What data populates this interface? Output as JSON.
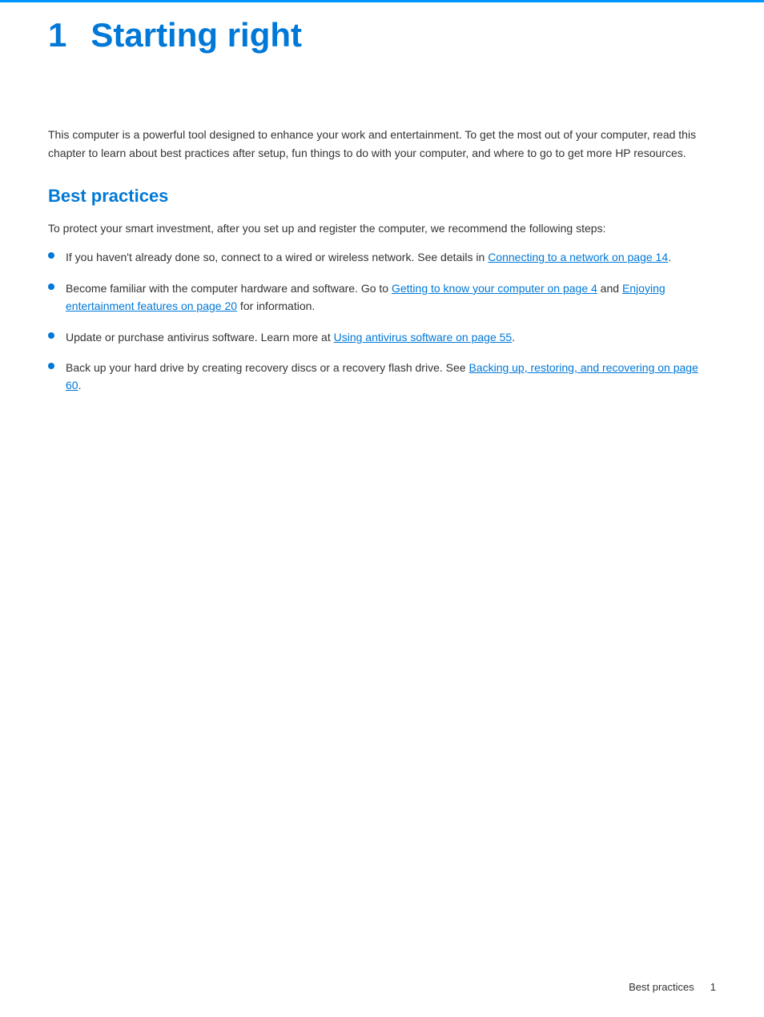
{
  "page": {
    "top_rule_color": "#0096FF"
  },
  "header": {
    "chapter_number": "1",
    "chapter_title": "Starting right"
  },
  "intro": {
    "paragraph": "This computer is a powerful tool designed to enhance your work and entertainment. To get the most out of your computer, read this chapter to learn about best practices after setup, fun things to do with your computer, and where to go to get more HP resources."
  },
  "best_practices": {
    "section_title": "Best practices",
    "section_intro": "To protect your smart investment, after you set up and register the computer, we recommend the following steps:",
    "bullets": [
      {
        "id": 1,
        "text_before": "If you haven’t already done so, connect to a wired or wireless network. See details in ",
        "link_text": "Connecting to a network on page 14",
        "text_after": ".",
        "link_href": "#"
      },
      {
        "id": 2,
        "text_before": "Become familiar with the computer hardware and software. Go to ",
        "link1_text": "Getting to know your computer on page 4",
        "link1_href": "#",
        "text_middle": " and ",
        "link2_text": "Enjoying entertainment features on page 20",
        "link2_href": "#",
        "text_after": " for information."
      },
      {
        "id": 3,
        "text_before": "Update or purchase antivirus software. Learn more at ",
        "link_text": "Using antivirus software on page 55",
        "link_href": "#",
        "text_after": "."
      },
      {
        "id": 4,
        "text_before": "Back up your hard drive by creating recovery discs or a recovery flash drive. See ",
        "link_text": "Backing up, restoring, and recovering on page 60",
        "link_href": "#",
        "text_after": "."
      }
    ]
  },
  "footer": {
    "section_label": "Best practices",
    "page_number": "1"
  }
}
